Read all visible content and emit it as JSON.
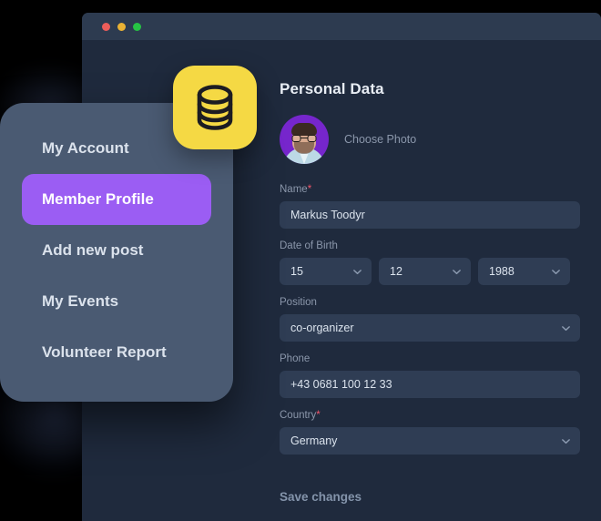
{
  "window": {
    "traffic_lights": [
      {
        "name": "close",
        "color": "#ec5d5a"
      },
      {
        "name": "minimize",
        "color": "#eab234"
      },
      {
        "name": "maximize",
        "color": "#26c344"
      }
    ]
  },
  "app_icon": {
    "name": "database-icon",
    "background": "#f5d944",
    "glyph_color": "#1c1c22"
  },
  "sidebar": {
    "background": "#4a5a72",
    "active_color": "#9b5df3",
    "items": [
      {
        "label": "My Account",
        "active": false
      },
      {
        "label": "Member Profile",
        "active": true
      },
      {
        "label": "Add new post",
        "active": false
      },
      {
        "label": "My Events",
        "active": false
      },
      {
        "label": "Volunteer Report",
        "active": false
      }
    ]
  },
  "form": {
    "title": "Personal Data",
    "photo": {
      "choose_label": "Choose Photo",
      "avatar_background": "#7626cc"
    },
    "name": {
      "label": "Name",
      "required": "*",
      "value": "Markus Toodyr"
    },
    "date_of_birth": {
      "label": "Date of Birth",
      "day": "15",
      "month": "12",
      "year": "1988"
    },
    "position": {
      "label": "Position",
      "value": "co-organizer"
    },
    "phone": {
      "label": "Phone",
      "value": "+43 0681 100 12 33"
    },
    "country": {
      "label": "Country",
      "required": "*",
      "value": "Germany"
    },
    "save_label": "Save changes",
    "required_marker_color": "#f2556a"
  }
}
